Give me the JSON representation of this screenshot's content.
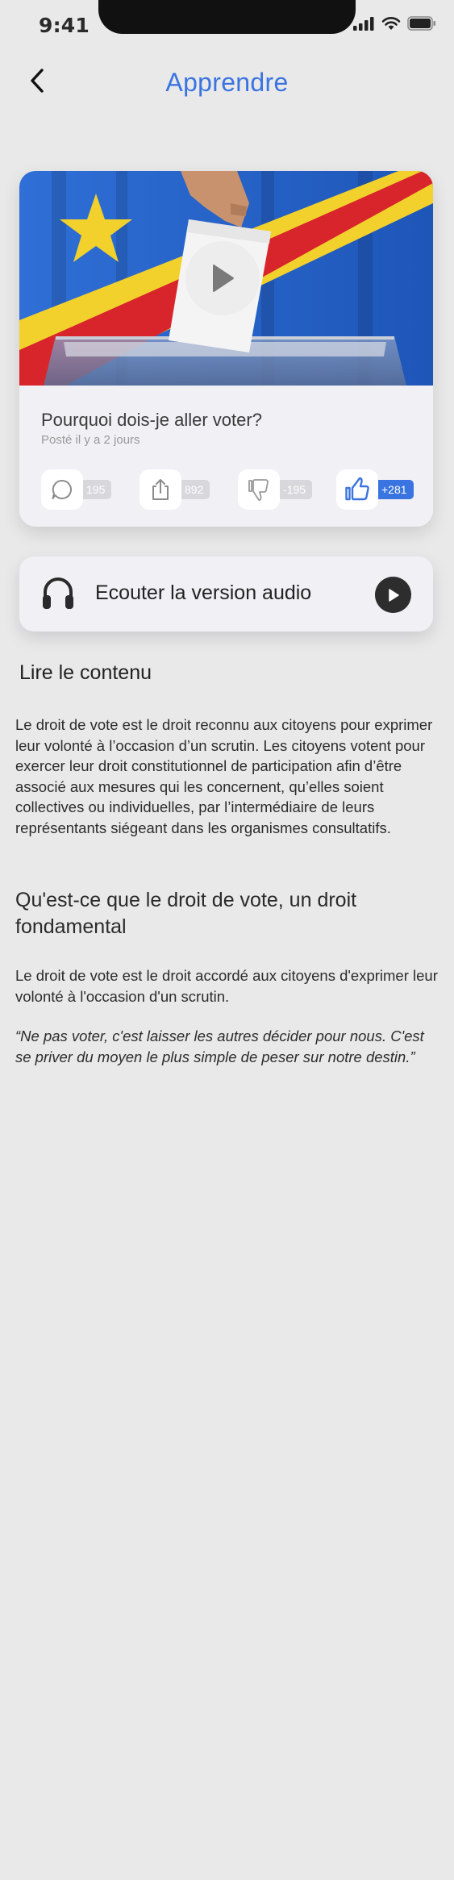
{
  "status_bar": {
    "time": "9:41"
  },
  "header": {
    "title": "Apprendre"
  },
  "video_card": {
    "title": "Pourquoi dois-je aller voter?",
    "meta": "Posté il y a 2 jours",
    "actions": {
      "comments": "195",
      "shares": "892",
      "dislikes": "-195",
      "likes": "+281"
    }
  },
  "audio": {
    "label": "Ecouter la version audio"
  },
  "content": {
    "heading": "Lire le contenu",
    "paragraph1": "Le droit de vote est le droit reconnu aux citoyens pour exprimer leur volonté à l’occasion d’un scrutin. Les citoyens votent pour exercer leur droit constitutionnel de participation afin d’être associé aux mesures qui les concernent, qu’elles soient collectives ou individuelles, par l’intermédiaire de leurs représentants siégeant dans les organismes consultatifs.",
    "subheading": "Qu'est-ce que le droit de vote, un droit fondamental",
    "paragraph2": "Le droit de vote est le droit accordé aux citoyens d'exprimer leur volonté à l'occasion d'un scrutin.",
    "quote": "“Ne pas voter, c'est laisser les autres décider pour nous. C'est se priver du moyen le plus simple de peser sur notre destin.”"
  },
  "colors": {
    "accent": "#3a74e0",
    "background": "#e9e9ea",
    "card": "#f0f0f5",
    "count_badge": "#d8d8dc"
  }
}
